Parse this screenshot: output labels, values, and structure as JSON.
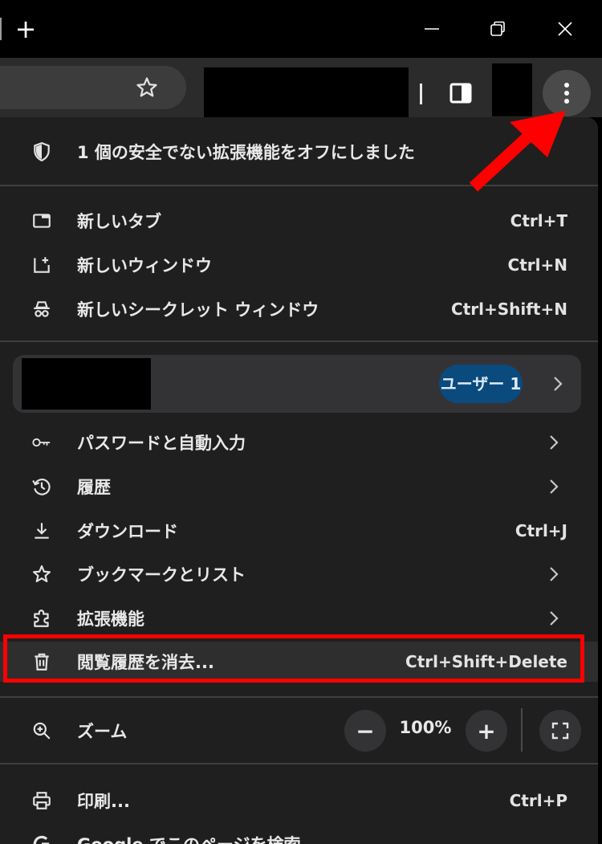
{
  "titlebar": {
    "new_tab_glyph": "+",
    "minimize_icon": "minimize-icon",
    "restore_icon": "restore-icon",
    "close_icon": "close-icon"
  },
  "toolbar": {
    "bookmark_icon": "star-icon",
    "side_panel_icon": "side-panel-icon",
    "menu_icon": "three-dots-vertical-icon"
  },
  "menu": {
    "notice": {
      "icon": "shield-icon",
      "label": "1 個の安全でない拡張機能をオフにしました"
    },
    "new_tab": {
      "icon": "new-tab-icon",
      "label": "新しいタブ",
      "shortcut": "Ctrl+T"
    },
    "new_window": {
      "icon": "new-window-icon",
      "label": "新しいウィンドウ",
      "shortcut": "Ctrl+N"
    },
    "incognito": {
      "icon": "incognito-icon",
      "label": "新しいシークレット ウィンドウ",
      "shortcut": "Ctrl+Shift+N"
    },
    "profile": {
      "badge": "ユーザー 1"
    },
    "passwords": {
      "icon": "key-icon",
      "label": "パスワードと自動入力"
    },
    "history": {
      "icon": "history-icon",
      "label": "履歴"
    },
    "downloads": {
      "icon": "download-icon",
      "label": "ダウンロード",
      "shortcut": "Ctrl+J"
    },
    "bookmarks": {
      "icon": "star-icon",
      "label": "ブックマークとリスト"
    },
    "extensions": {
      "icon": "puzzle-icon",
      "label": "拡張機能"
    },
    "clear_data": {
      "icon": "trash-icon",
      "label": "閲覧履歴を消去...",
      "shortcut": "Ctrl+Shift+Delete"
    },
    "zoom": {
      "icon": "zoom-icon",
      "label": "ズーム",
      "minus": "−",
      "value": "100%",
      "plus": "+",
      "fullscreen_icon": "fullscreen-icon"
    },
    "print": {
      "icon": "print-icon",
      "label": "印刷...",
      "shortcut": "Ctrl+P"
    },
    "search_page": {
      "icon": "google-icon",
      "label": "Google でこのページを検索..."
    }
  },
  "colors": {
    "menu_bg": "#1f1f1f",
    "toolbar_bg": "#2b2b2b",
    "highlight": "#ff0000",
    "arrow": "#ff0000",
    "badge_bg": "#0b4a7d"
  }
}
